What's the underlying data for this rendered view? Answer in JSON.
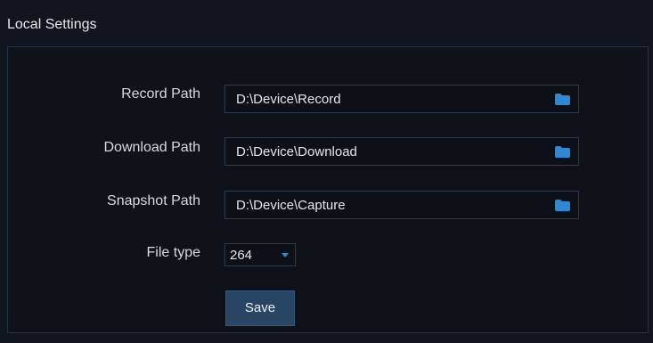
{
  "panel": {
    "title": "Local Settings"
  },
  "settings": {
    "record_path": {
      "label": "Record Path",
      "value": "D:\\Device\\Record",
      "icon": "folder-icon"
    },
    "download_path": {
      "label": "Download Path",
      "value": "D:\\Device\\Download",
      "icon": "folder-icon"
    },
    "snapshot_path": {
      "label": "Snapshot Path",
      "value": "D:\\Device\\Capture",
      "icon": "folder-icon"
    },
    "file_type": {
      "label": "File type",
      "value": "264"
    }
  },
  "actions": {
    "save_label": "Save"
  },
  "colors": {
    "accent": "#2f88d6",
    "button_bg": "#284663",
    "panel_border": "#253347"
  }
}
